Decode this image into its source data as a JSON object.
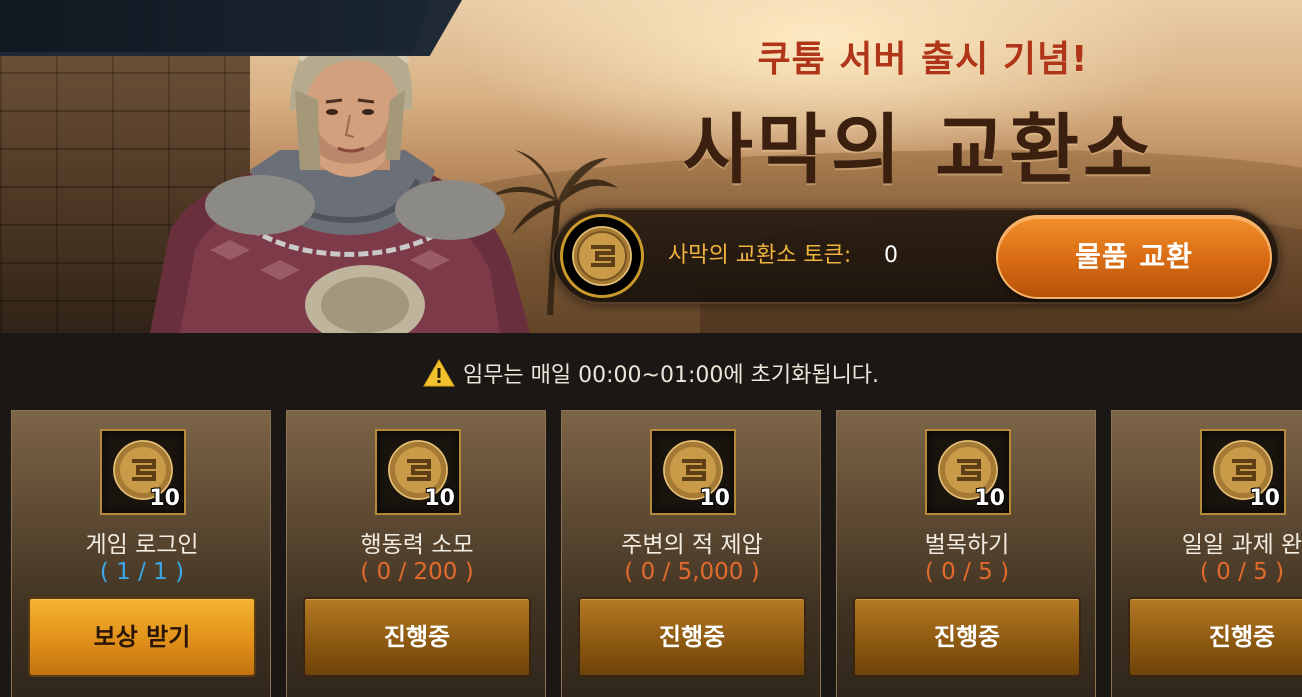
{
  "banner": {
    "subtitle": "쿠툼 서버 출시 기념!",
    "title": "사막의 교환소"
  },
  "token": {
    "label": "사막의 교환소 토큰:",
    "count": "0",
    "icon": "desert-token-coin-icon"
  },
  "exchange_button": {
    "label": "물품 교환"
  },
  "notice": {
    "icon": "warning-icon",
    "text": "임무는 매일 00:00~01:00에 초기화됩니다."
  },
  "missions": [
    {
      "name": "게임 로그인",
      "progress": "( 1 / 1 )",
      "reward_qty": "10",
      "button": "보상 받기",
      "status": "complete"
    },
    {
      "name": "행동력 소모",
      "progress": "( 0 / 200 )",
      "reward_qty": "10",
      "button": "진행중",
      "status": "in-progress"
    },
    {
      "name": "주변의 적 제압",
      "progress": "( 0 / 5,000 )",
      "reward_qty": "10",
      "button": "진행중",
      "status": "in-progress"
    },
    {
      "name": "벌목하기",
      "progress": "( 0 / 5 )",
      "reward_qty": "10",
      "button": "진행중",
      "status": "in-progress"
    },
    {
      "name": "일일 과제 완",
      "progress": "( 0 / 5 )",
      "reward_qty": "10",
      "button": "진행중",
      "status": "in-progress"
    }
  ],
  "colors": {
    "accent_orange": "#e07a18",
    "token_label": "#f0b33f",
    "progress_pending": "#e26a2c",
    "progress_done": "#3aa7e8"
  }
}
